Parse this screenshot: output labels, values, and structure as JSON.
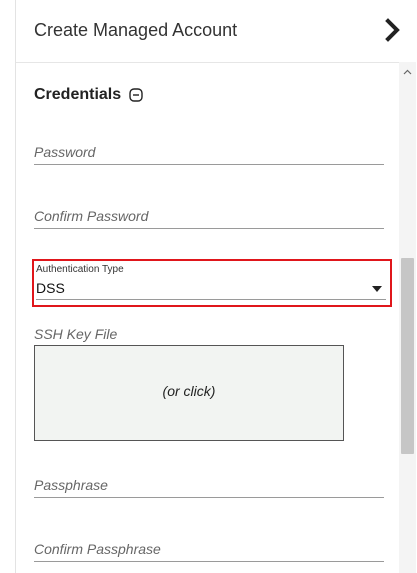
{
  "header": {
    "title": "Create Managed Account",
    "collapse_icon": "chevron-right-icon"
  },
  "credentials": {
    "section_title": "Credentials",
    "toggle_icon": "minus-circle-icon",
    "password": {
      "placeholder": "Password",
      "value": ""
    },
    "confirm_password": {
      "placeholder": "Confirm Password",
      "value": ""
    },
    "auth_type": {
      "label": "Authentication Type",
      "value": "DSS"
    },
    "ssh_key_file": {
      "label": "SSH Key File",
      "dropzone_text": "(or click)"
    },
    "passphrase": {
      "placeholder": "Passphrase",
      "value": ""
    },
    "confirm_passphrase": {
      "placeholder": "Confirm Passphrase",
      "value": ""
    }
  },
  "colors": {
    "highlight_border": "#e0161b",
    "dropzone_bg": "#f2f4f2",
    "scrollbar_thumb": "#c6c6c6"
  }
}
